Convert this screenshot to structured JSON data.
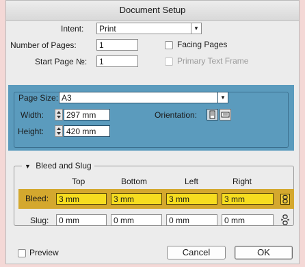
{
  "dialog": {
    "title": "Document Setup"
  },
  "intent": {
    "label": "Intent:",
    "value": "Print"
  },
  "pages": {
    "number_label": "Number of Pages:",
    "number_value": "1",
    "start_label": "Start Page №:",
    "start_value": "1",
    "facing_label": "Facing Pages",
    "facing_checked": false,
    "primary_label": "Primary Text Frame",
    "primary_checked": false
  },
  "page_size": {
    "label": "Page Size:",
    "value": "A3",
    "width_label": "Width:",
    "width_value": "297 mm",
    "height_label": "Height:",
    "height_value": "420 mm",
    "orientation_label": "Orientation:",
    "orientation_selected": "portrait"
  },
  "bleed_slug": {
    "section_label": "Bleed and Slug",
    "columns": [
      "Top",
      "Bottom",
      "Left",
      "Right"
    ],
    "bleed_label": "Bleed:",
    "bleed_values": [
      "3 mm",
      "3 mm",
      "3 mm",
      "3 mm"
    ],
    "slug_label": "Slug:",
    "slug_values": [
      "0 mm",
      "0 mm",
      "0 mm",
      "0 mm"
    ]
  },
  "footer": {
    "preview_label": "Preview",
    "cancel_label": "Cancel",
    "ok_label": "OK"
  },
  "colors": {
    "page_size_highlight": "#5b9bbd",
    "bleed_highlight": "#d4a82e",
    "bleed_field": "#f6dd1f"
  }
}
